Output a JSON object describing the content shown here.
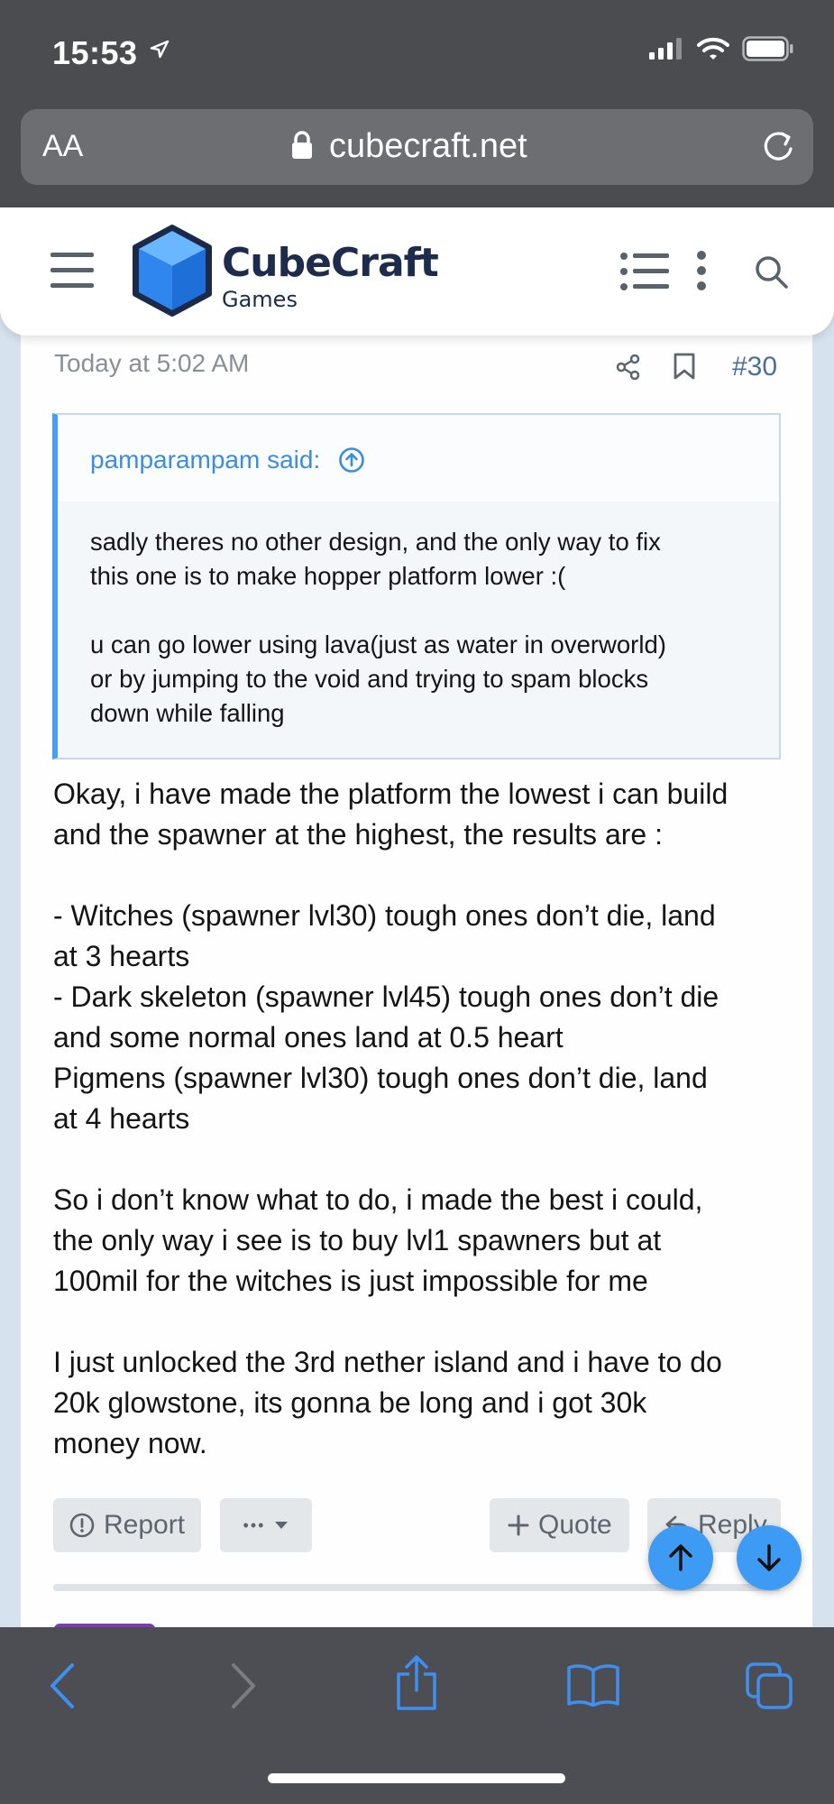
{
  "status_bar": {
    "time": "15:53"
  },
  "url_bar": {
    "text_size_label": "AA",
    "url": "cubecraft.net"
  },
  "header": {
    "brand_name": "CubeCraft",
    "brand_sub": "Games"
  },
  "post": {
    "date": "Today at 5:02 AM",
    "number": "#30",
    "quote": {
      "author": "pamparampam said:",
      "paragraphs": [
        [
          "sadly theres no other design, and the only way to fix",
          "this one is to make hopper platform lower :("
        ],
        [
          "u can go lower using lava(just as water in overworld)",
          "or by jumping to the void and trying to spam blocks",
          "down while falling"
        ]
      ]
    },
    "message_lines": [
      "Okay, i have made the platform the lowest i can build",
      "and the spawner at the highest, the results are :",
      "",
      "- Witches (spawner lvl30) tough ones don’t die, land",
      "at 3 hearts",
      "- Dark skeleton (spawner lvl45) tough ones don’t die",
      "and some normal ones land at 0.5 heart",
      "Pigmens (spawner lvl30) tough ones don’t die, land",
      "at 4 hearts",
      "",
      "So i don’t know what to do, i made the best i could,",
      "the only way i see is to buy lvl1 spawners but at",
      "100mil for the witches is just impossible for me",
      "",
      "I just unlocked the 3rd nether island and i have to do",
      "20k glowstone, its gonna be long and i got 30k",
      "money now."
    ],
    "actions": {
      "report": "Report",
      "more": "•••",
      "quote": "Quote",
      "reply": "Reply"
    }
  },
  "colors": {
    "accent": "#3d9bf3",
    "quote_border": "#4a9ef0",
    "brand_navy": "#1d2b4c",
    "toolbar_icon": "#3f8ff0"
  }
}
